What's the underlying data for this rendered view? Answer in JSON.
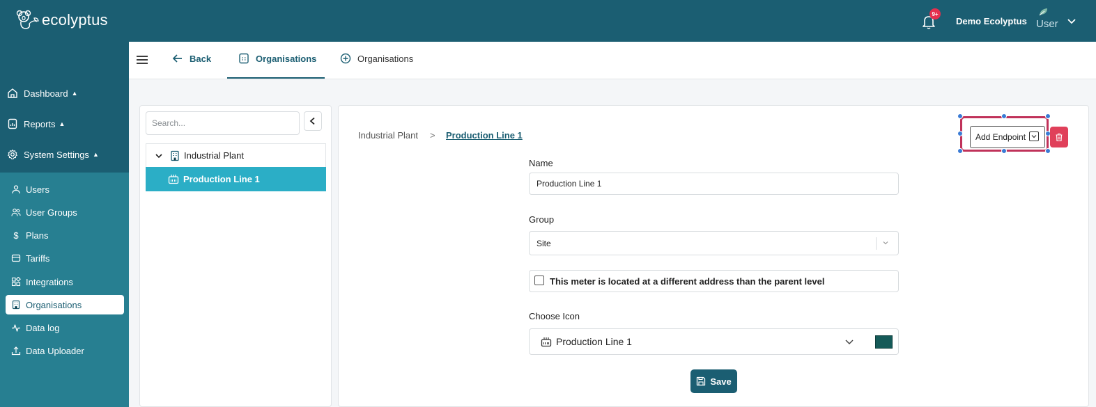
{
  "app": {
    "logo_text": "ecolyptus",
    "notification_badge": "9+",
    "user_name": "Demo Ecolyptus",
    "avatar_text": "User"
  },
  "sidebar": {
    "main": [
      {
        "label": "Dashboard",
        "icon": "home-icon"
      },
      {
        "label": "Reports",
        "icon": "report-icon"
      },
      {
        "label": "System Settings",
        "icon": "gear-icon"
      }
    ],
    "sub": [
      {
        "label": "Users",
        "icon": "user-icon"
      },
      {
        "label": "User Groups",
        "icon": "users-icon"
      },
      {
        "label": "Plans",
        "icon": "dollar-icon"
      },
      {
        "label": "Tariffs",
        "icon": "tariff-icon"
      },
      {
        "label": "Integrations",
        "icon": "integrations-icon"
      },
      {
        "label": "Organisations",
        "icon": "building-icon",
        "active": true
      },
      {
        "label": "Data log",
        "icon": "pulse-icon"
      },
      {
        "label": "Data Uploader",
        "icon": "upload-icon"
      }
    ]
  },
  "tabs": {
    "back": "Back",
    "organisations": "Organisations",
    "add_organisations": "Organisations"
  },
  "tree": {
    "search_placeholder": "Search...",
    "parent": "Industrial Plant",
    "child": "Production Line 1"
  },
  "breadcrumb": {
    "root": "Industrial Plant",
    "separator": ">",
    "current": "Production Line 1"
  },
  "form": {
    "name_label": "Name",
    "name_value": "Production Line 1",
    "group_label": "Group",
    "group_value": "Site",
    "checkbox_label": "This meter is located at a different address than the parent level",
    "checkbox_checked": false,
    "icon_label": "Choose Icon",
    "icon_value": "Production Line 1",
    "icon_color": "#155a58",
    "save_label": "Save"
  },
  "actions": {
    "add_endpoint": "Add Endpoint"
  },
  "colors": {
    "primary": "#1b5e72",
    "active_tree": "#2baec6",
    "danger": "#e0405a",
    "highlight": "#c0325a"
  }
}
